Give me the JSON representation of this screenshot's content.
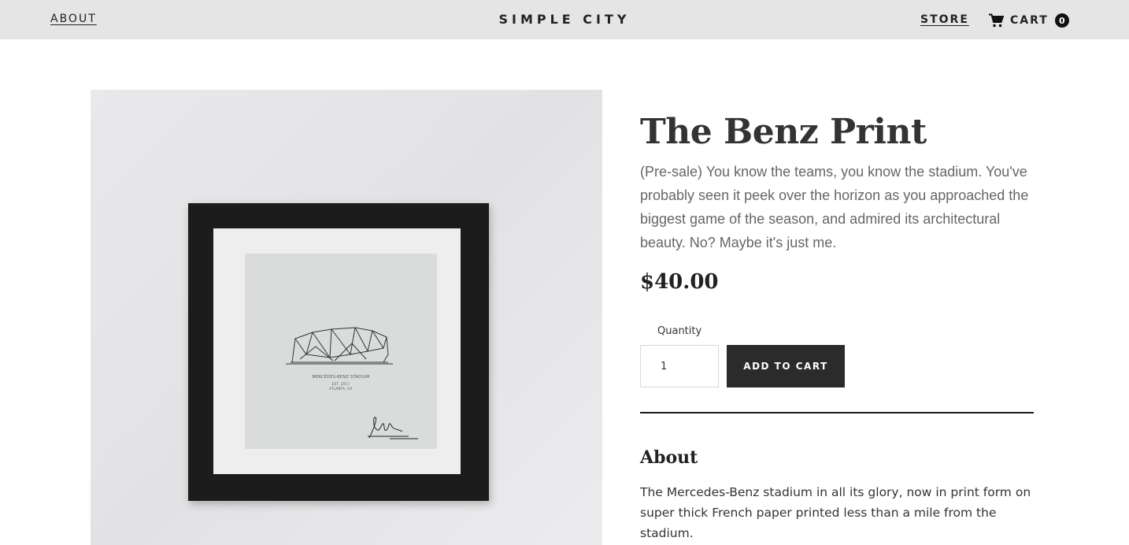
{
  "header": {
    "about_label": "ABOUT",
    "brand": "SIMPLE CITY",
    "store_label": "STORE",
    "cart_label": "CART",
    "cart_count": "0",
    "cart_icon": "shopping-cart-icon",
    "background_color": "#e5e5e5"
  },
  "product": {
    "title": "The Benz Print",
    "description": "(Pre-sale) You know the teams, you know the stadium. You've probably seen it peek over the horizon as you approached the biggest game of the season, and admired its architectural beauty. No? Maybe it's just me.",
    "price": "$40.00",
    "quantity_label": "Quantity",
    "quantity_value": "1",
    "add_to_cart_label": "ADD TO CART",
    "button_color": "#2b2b2b",
    "image": {
      "caption_title": "MERCEDES-BENZ STADIUM",
      "caption_line2": "EST. 2017",
      "caption_line3": "ATLANTA, GA"
    }
  },
  "about": {
    "heading": "About",
    "text": "The Mercedes-Benz stadium in all its glory, now in print form on super thick French paper printed less than a mile from the stadium."
  }
}
